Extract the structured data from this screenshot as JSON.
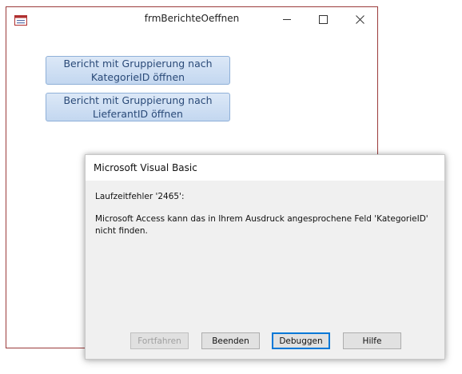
{
  "form": {
    "title": "frmBerichteOeffnen",
    "buttons": [
      {
        "label": "Bericht mit Gruppierung nach\nKategorieID öffnen"
      },
      {
        "label": "Bericht mit Gruppierung nach\nLieferantID öffnen"
      }
    ],
    "icons": [
      "form-icon",
      "minimize-icon",
      "maximize-icon",
      "close-icon"
    ]
  },
  "dialog": {
    "title": "Microsoft Visual Basic",
    "error_head": "Laufzeitfehler '2465':",
    "error_message": "Microsoft Access kann das in Ihrem Ausdruck angesprochene Feld 'KategorieID' nicht finden.",
    "buttons": {
      "continue": "Fortfahren",
      "end": "Beenden",
      "debug": "Debuggen",
      "help": "Hilfe"
    }
  },
  "colors": {
    "form_border": "#9b3b3b",
    "button_fill": "#c3d7f0",
    "button_text": "#2a4a78",
    "focus_blue": "#0078d7"
  }
}
